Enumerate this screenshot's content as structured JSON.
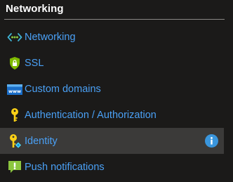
{
  "section": {
    "title": "Networking"
  },
  "nav": {
    "items": [
      {
        "label": "Networking",
        "icon": "networking-icon"
      },
      {
        "label": "SSL",
        "icon": "ssl-shield-icon"
      },
      {
        "label": "Custom domains",
        "icon": "www-icon"
      },
      {
        "label": "Authentication / Authorization",
        "icon": "key-icon"
      },
      {
        "label": "Identity",
        "icon": "identity-key-icon",
        "selected": true,
        "badge": "info-icon"
      },
      {
        "label": "Push notifications",
        "icon": "notification-icon"
      }
    ]
  },
  "colors": {
    "background": "#1b1a19",
    "selected_background": "#3b3a39",
    "link": "#4aa0f5",
    "info_badge": "#3a96dd"
  }
}
